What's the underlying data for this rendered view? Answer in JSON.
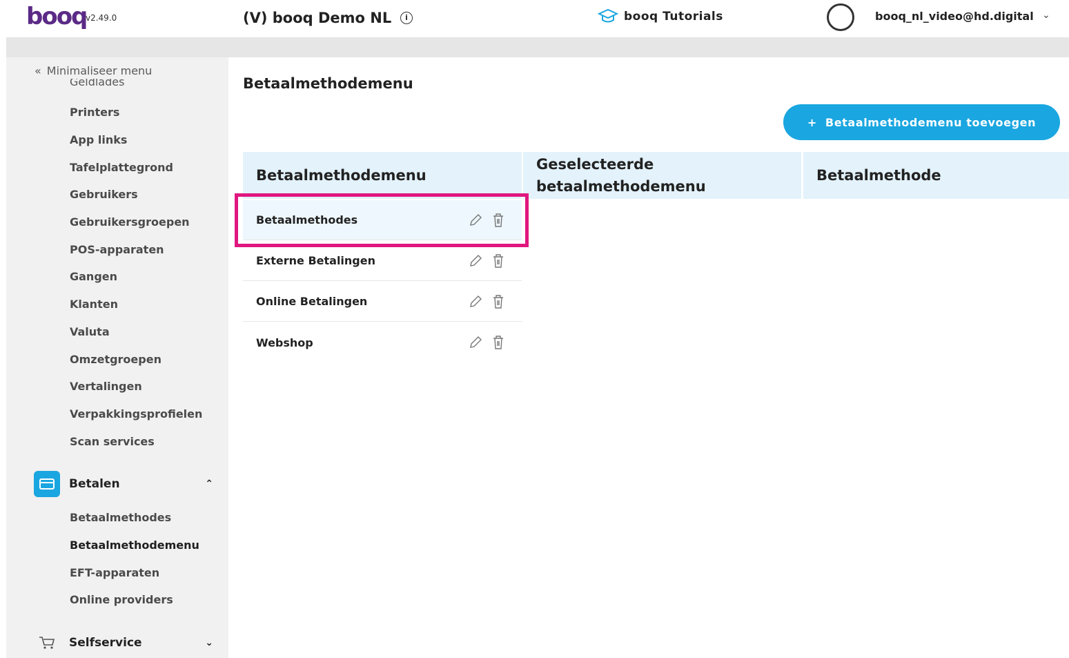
{
  "header": {
    "logo": "booq",
    "version": "v2.49.0",
    "venue": "(V) booq Demo NL",
    "tutorials_label": "booq Tutorials",
    "user_email": "booq_nl_video@hd.digital"
  },
  "sidebar": {
    "minimize_label": "Minimaliseer menu",
    "cut_item": "Geldlades",
    "items": [
      {
        "label": "Printers"
      },
      {
        "label": "App links"
      },
      {
        "label": "Tafelplattegrond"
      },
      {
        "label": "Gebruikers"
      },
      {
        "label": "Gebruikersgroepen"
      },
      {
        "label": "POS-apparaten"
      },
      {
        "label": "Gangen"
      },
      {
        "label": "Klanten"
      },
      {
        "label": "Valuta"
      },
      {
        "label": "Omzetgroepen"
      },
      {
        "label": "Vertalingen"
      },
      {
        "label": "Verpakkingsprofielen"
      },
      {
        "label": "Scan services"
      }
    ],
    "betalen_section": {
      "label": "Betalen",
      "items": [
        {
          "label": "Betaalmethodes"
        },
        {
          "label": "Betaalmethodemenu"
        },
        {
          "label": "EFT-apparaten"
        },
        {
          "label": "Online providers"
        }
      ]
    },
    "selfservice_section": {
      "label": "Selfservice"
    }
  },
  "main": {
    "title": "Betaalmethodemenu",
    "add_button": "Betaalmethodemenu toevoegen",
    "columns": {
      "menu": "Betaalmethodemenu",
      "selected_line1": "Geselecteerde",
      "selected_line2": "betaalmethodemenu",
      "method": "Betaalmethode"
    },
    "rows": [
      {
        "label": "Betaalmethodes"
      },
      {
        "label": "Externe Betalingen"
      },
      {
        "label": "Online Betalingen"
      },
      {
        "label": "Webshop"
      }
    ]
  },
  "colors": {
    "accent": "#1aa6e0",
    "highlight": "#e0177f",
    "brand": "#5b2a86"
  }
}
